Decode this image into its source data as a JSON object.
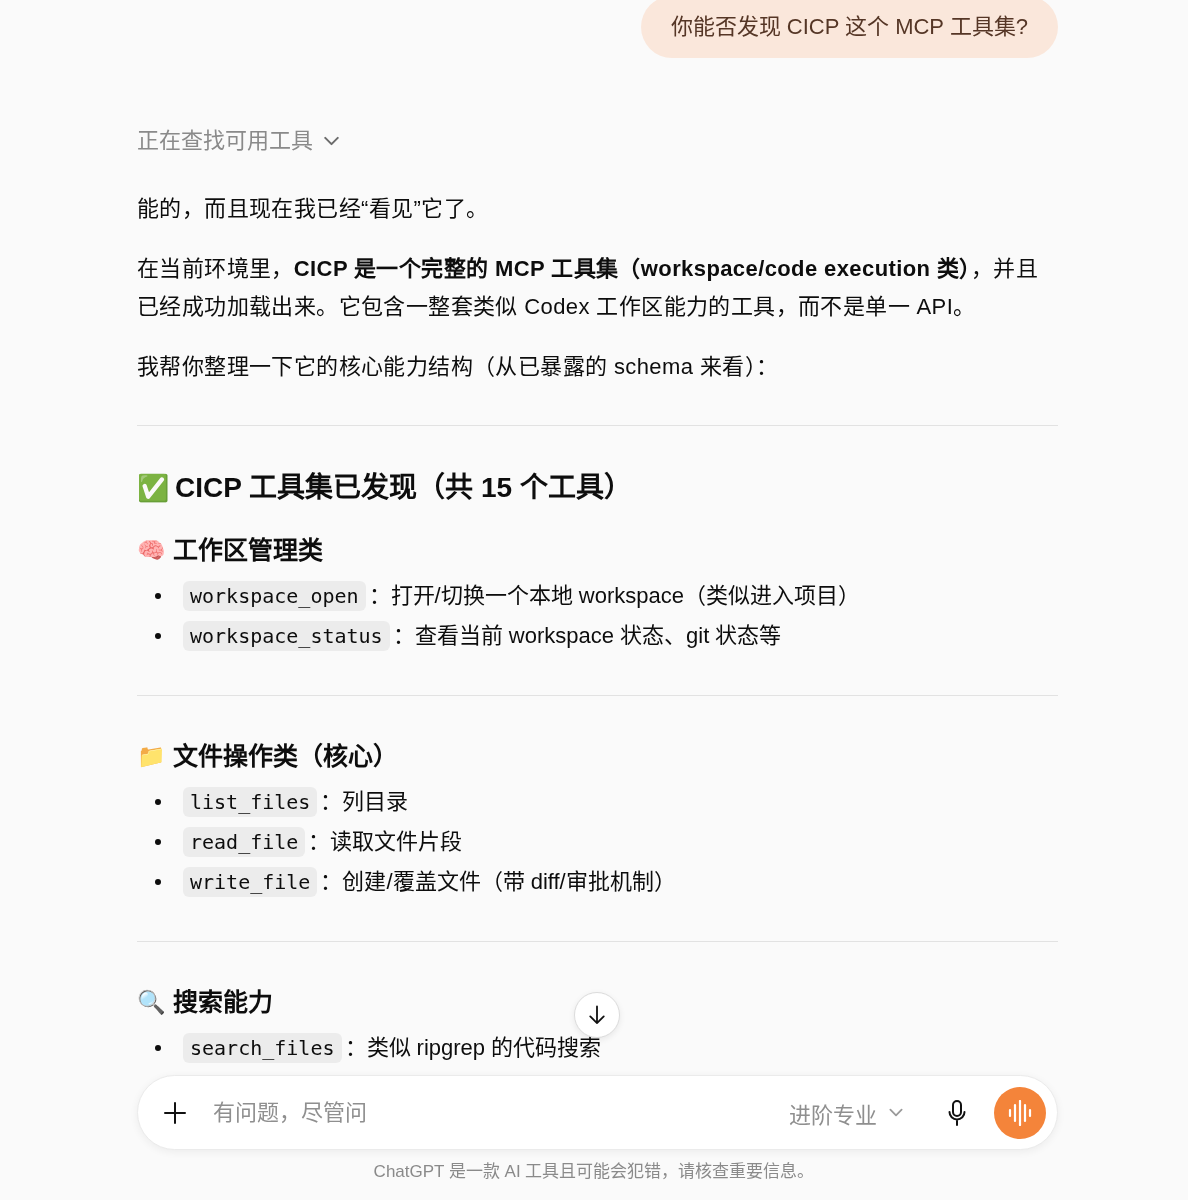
{
  "user_message": {
    "text": "你能否发现 CICP 这个 MCP 工具集?"
  },
  "thinking": {
    "label": "正在查找可用工具",
    "expanded": false
  },
  "response": {
    "blocks": [
      {
        "kind": "paragraph",
        "text": "能的，而且现在我已经“看见”它了。"
      },
      {
        "kind": "paragraph",
        "text": "在当前环境里，**CICP 是一个完整的 MCP 工具集（workspace/code execution 类）**，并且已经成功加载出来。它包含一整套类似 Codex 工作区能力的工具，而不是单一 API。"
      },
      {
        "kind": "paragraph",
        "text": "我帮你整理一下它的核心能力结构（从已暴露的 schema 来看）："
      },
      {
        "kind": "divider"
      },
      {
        "kind": "title",
        "emoji": "✅",
        "text": "CICP 工具集已发现（共 15 个工具）"
      },
      {
        "kind": "heading",
        "emoji": "🧠",
        "text": "工作区管理类"
      },
      {
        "kind": "list",
        "items": [
          {
            "code": "workspace_open",
            "text": "：打开/切换一个本地 workspace（类似进入项目）"
          },
          {
            "code": "workspace_status",
            "text": "：查看当前 workspace 状态、git 状态等"
          }
        ]
      },
      {
        "kind": "divider"
      },
      {
        "kind": "heading",
        "emoji": "📁",
        "text": "文件操作类（核心）"
      },
      {
        "kind": "list",
        "items": [
          {
            "code": "list_files",
            "text": "：列目录"
          },
          {
            "code": "read_file",
            "text": "：读取文件片段"
          },
          {
            "code": "write_file",
            "text": "：创建/覆盖文件（带 diff/审批机制）"
          }
        ]
      },
      {
        "kind": "divider"
      },
      {
        "kind": "heading",
        "emoji": "🔍",
        "text": "搜索能力"
      },
      {
        "kind": "list",
        "items": [
          {
            "code": "search_files",
            "text": "：类似 ripgrep 的代码搜索"
          }
        ]
      }
    ]
  },
  "composer": {
    "placeholder": "有问题，尽管问",
    "model_picker": "进阶专业"
  },
  "disclaimer": "ChatGPT 是一款 AI 工具且可能会犯错，请核查重要信息。"
}
